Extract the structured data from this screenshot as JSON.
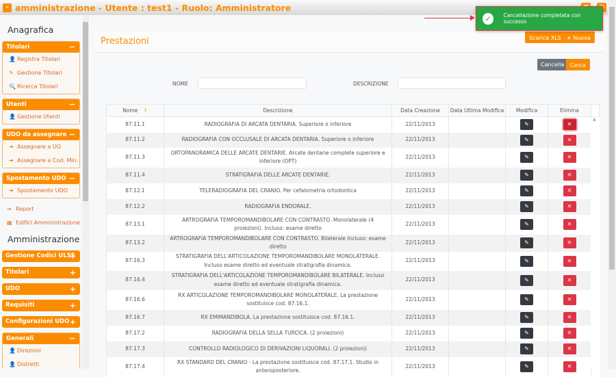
{
  "app": {
    "title": "amministrazione - Utente : test1 - Ruolo: Amministratore"
  },
  "sidebar": {
    "anagrafica_title": "Anagrafica",
    "panels": [
      {
        "title": "Titolari",
        "toggle": "−",
        "items": [
          {
            "label": "Registra Titolari",
            "icon": "user-edit-icon"
          },
          {
            "label": "Gestione Titolari",
            "icon": "edit-icon"
          },
          {
            "label": "Ricerca Titolari",
            "icon": "search-icon"
          }
        ]
      },
      {
        "title": "Utenti",
        "toggle": "−",
        "items": [
          {
            "label": "Gestione Utenti",
            "icon": "user-edit-icon"
          }
        ]
      },
      {
        "title": "UDO da assegnare",
        "toggle": "−",
        "items": [
          {
            "label": "Assegnare a UO",
            "icon": "arrow-right-icon"
          },
          {
            "label": "Assegnare a Cod. Min.",
            "icon": "arrow-right-icon"
          }
        ]
      },
      {
        "title": "Spostamento UDO",
        "toggle": "−",
        "items": [
          {
            "label": "Spostamento UDO",
            "icon": "arrow-right-icon"
          }
        ]
      }
    ],
    "links": [
      {
        "label": "Report",
        "icon": "arrow-right-icon"
      },
      {
        "label": "Edifici Amministrazione",
        "icon": "building-icon"
      }
    ],
    "amministrazione_title": "Amministrazione",
    "collapsed": [
      {
        "title": "Gestione Codici ULSS",
        "toggle": "+"
      },
      {
        "title": "Titolari",
        "toggle": "+"
      },
      {
        "title": "UDO",
        "toggle": "+"
      },
      {
        "title": "Requisiti",
        "toggle": "+"
      },
      {
        "title": "Configurazioni UDO",
        "toggle": "+"
      }
    ],
    "generali": {
      "title": "Generali",
      "toggle": "−",
      "items": [
        {
          "label": "Direzioni",
          "icon": "user-edit-icon"
        },
        {
          "label": "Distretti",
          "icon": "user-edit-icon"
        }
      ]
    }
  },
  "main": {
    "title": "Prestazioni",
    "buttons": {
      "xls": "Scarica XLS",
      "new": "Nuova",
      "clear": "Cancella",
      "search": "Cerca"
    },
    "filters": {
      "nome_label": "NOME",
      "nome_value": "",
      "descr_label": "DESCRIZIONE",
      "descr_value": ""
    },
    "columns": [
      "Nome",
      "Descrizione",
      "Data Creazione",
      "Data Ultima Modifica",
      "Modifica",
      "Elimina"
    ],
    "rows": [
      {
        "nome": "87.11.1",
        "descr": "RADIOGRAFIA DI ARCATA DENTARIA. Superiore o inferiore",
        "created": "22/11/2013",
        "modified": ""
      },
      {
        "nome": "87.11.2",
        "descr": "RADIOGRAFIA CON OCCLUSALE DI ARCATA DENTARIA. Superiore o inferiore",
        "created": "22/11/2013",
        "modified": ""
      },
      {
        "nome": "87.11.3",
        "descr": "ORTOPANORAMICA DELLE ARCATE DENTARIE. Arcate dentarie complete superiore e inferiore (OPT)",
        "created": "22/11/2013",
        "modified": ""
      },
      {
        "nome": "87.11.4",
        "descr": "STRATIGRAFIA DELLE ARCATE DENTARIE.",
        "created": "22/11/2013",
        "modified": ""
      },
      {
        "nome": "87.12.1",
        "descr": "TELERADIOGRAFIA DEL CRANIO. Per cefalometria ortodontica",
        "created": "22/11/2013",
        "modified": ""
      },
      {
        "nome": "87.12.2",
        "descr": "RADIOGRAFIA ENDORALE.",
        "created": "22/11/2013",
        "modified": ""
      },
      {
        "nome": "87.13.1",
        "descr": "ARTROGRAFIA TEMPOROMANDIBOLARE CON CONTRASTO. Monolaterale (4 proiezioni). Incluso: esame diretto",
        "created": "22/11/2013",
        "modified": ""
      },
      {
        "nome": "87.13.2",
        "descr": "ARTROGRAFIA TEMPOROMANDIBOLARE CON CONTRASTO. Bilaterale Incluso: esame diretto",
        "created": "22/11/2013",
        "modified": ""
      },
      {
        "nome": "87.16.3",
        "descr": "STRATIGRAFIA DELL'ARTICOLAZIONE TEMPOROMANDIBOLARE MONOLATERALE. Incluso esame diretto ed eventuale stratigrafia dinamica.",
        "created": "22/11/2013",
        "modified": ""
      },
      {
        "nome": "87.16.4",
        "descr": "STRATIGRAFIA DELL'ARTICOLAZIONE TEMPOROMANDIBOLARE BILATERALE. Incluso esame diretto ed eventuale stratigrafia dinamica.",
        "created": "22/11/2013",
        "modified": ""
      },
      {
        "nome": "87.16.6",
        "descr": "RX ARTICOLAZIONE TEMPOROMANDIBOLARE MONOLATERALE. La prestazione sostituisce cod. 87.16.1.",
        "created": "22/11/2013",
        "modified": ""
      },
      {
        "nome": "87.16.7",
        "descr": "RX EMIMANDIBOLA. La prestazione sostituisce cod. 87.16.1.",
        "created": "22/11/2013",
        "modified": ""
      },
      {
        "nome": "87.17.2",
        "descr": "RADIOGRAFIA DELLA SELLA TURCICA. (2 proiezioni)",
        "created": "22/11/2013",
        "modified": ""
      },
      {
        "nome": "87.17.3",
        "descr": "CONTROLLO RADIOLOGICO DI DERIVAZIONI LIQUORALI. (2 proiezioni)",
        "created": "22/11/2013",
        "modified": ""
      },
      {
        "nome": "87.17.4",
        "descr": "RX STANDARD DEL CRANIO - La prestazione sostituisce cod. 87.17.1. Studio in anteroposteriore.",
        "created": "22/11/2013",
        "modified": ""
      }
    ]
  },
  "toast": {
    "message": "Cancellazione completata con successo",
    "icon": "check-circle-icon",
    "color": "#28a745"
  },
  "colors": {
    "accent": "#fb8c00",
    "danger": "#dc3545",
    "dark": "#343a40"
  }
}
